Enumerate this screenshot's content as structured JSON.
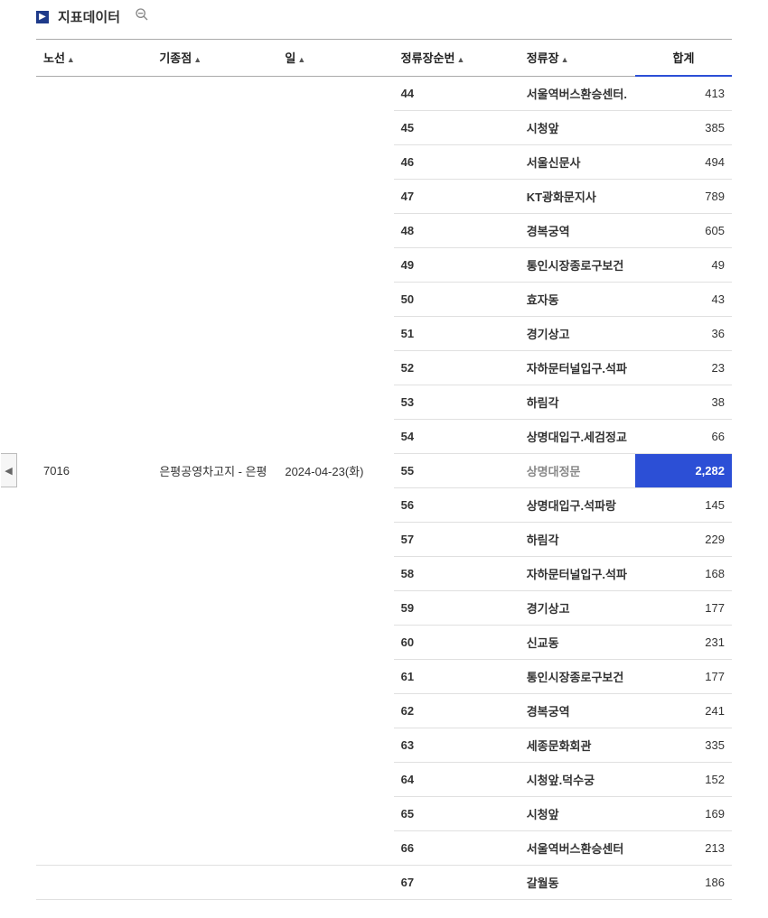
{
  "title": "지표데이터",
  "columns": {
    "route": "노선",
    "terminal": "기종점",
    "date": "일",
    "seq": "정류장순번",
    "stop": "정류장",
    "total": "합계"
  },
  "merged": {
    "route": "7016",
    "terminal": "은평공영차고지 - 은평",
    "date": "2024-04-23(화)"
  },
  "rows": [
    {
      "seq": "44",
      "stop": "서울역버스환승센터.",
      "total": "413"
    },
    {
      "seq": "45",
      "stop": "시청앞",
      "total": "385"
    },
    {
      "seq": "46",
      "stop": "서울신문사",
      "total": "494"
    },
    {
      "seq": "47",
      "stop": "KT광화문지사",
      "total": "789"
    },
    {
      "seq": "48",
      "stop": "경복궁역",
      "total": "605"
    },
    {
      "seq": "49",
      "stop": "통인시장종로구보건",
      "total": "49"
    },
    {
      "seq": "50",
      "stop": "효자동",
      "total": "43"
    },
    {
      "seq": "51",
      "stop": "경기상고",
      "total": "36"
    },
    {
      "seq": "52",
      "stop": "자하문터널입구.석파",
      "total": "23"
    },
    {
      "seq": "53",
      "stop": "하림각",
      "total": "38"
    },
    {
      "seq": "54",
      "stop": "상명대입구.세검정교",
      "total": "66"
    },
    {
      "seq": "55",
      "stop": "상명대정문",
      "total": "2,282",
      "selected": true
    },
    {
      "seq": "56",
      "stop": "상명대입구.석파랑",
      "total": "145"
    },
    {
      "seq": "57",
      "stop": "하림각",
      "total": "229"
    },
    {
      "seq": "58",
      "stop": "자하문터널입구.석파",
      "total": "168"
    },
    {
      "seq": "59",
      "stop": "경기상고",
      "total": "177"
    },
    {
      "seq": "60",
      "stop": "신교동",
      "total": "231"
    },
    {
      "seq": "61",
      "stop": "통인시장종로구보건",
      "total": "177"
    },
    {
      "seq": "62",
      "stop": "경복궁역",
      "total": "241"
    },
    {
      "seq": "63",
      "stop": "세종문화회관",
      "total": "335"
    },
    {
      "seq": "64",
      "stop": "시청앞.덕수궁",
      "total": "152"
    },
    {
      "seq": "65",
      "stop": "시청앞",
      "total": "169"
    },
    {
      "seq": "66",
      "stop": "서울역버스환승센터",
      "total": "213"
    },
    {
      "seq": "67",
      "stop": "갈월동",
      "total": "186",
      "separator": true
    }
  ]
}
